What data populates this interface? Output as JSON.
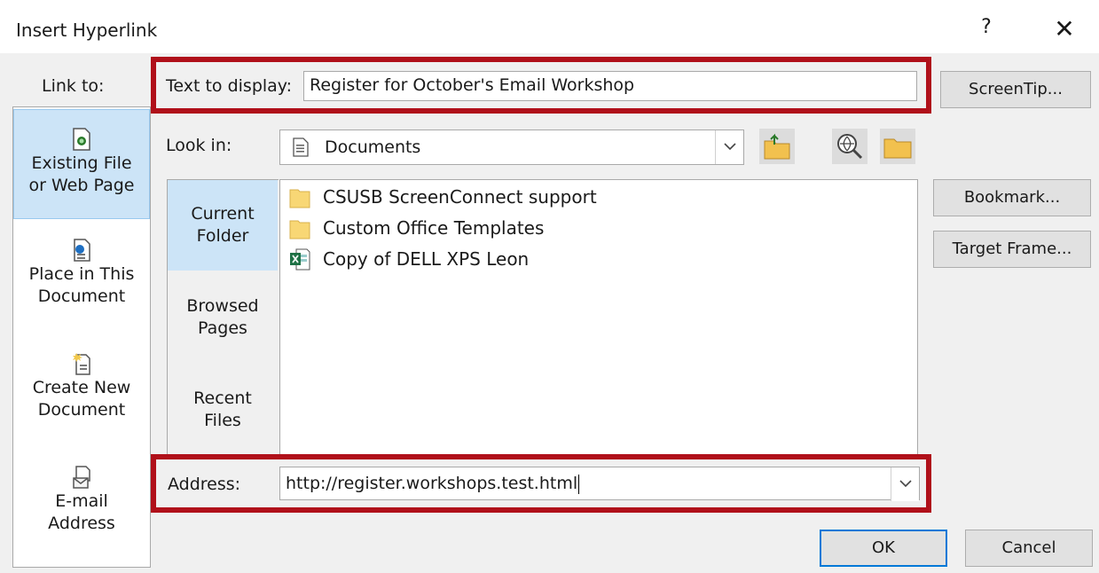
{
  "window": {
    "title": "Insert Hyperlink",
    "help_label": "?",
    "close_label": "✕"
  },
  "link_to": {
    "label": "Link to:",
    "items": [
      {
        "line1": "Existing File",
        "line2": "or Web Page",
        "icon": "web-page-icon",
        "selected": true
      },
      {
        "line1": "Place in This",
        "line2": "Document",
        "icon": "place-in-document-icon",
        "selected": false
      },
      {
        "line1": "Create New",
        "line2": "Document",
        "icon": "new-document-icon",
        "selected": false
      },
      {
        "line1": "E-mail",
        "line2": "Address",
        "icon": "email-icon",
        "selected": false
      }
    ]
  },
  "text_to_display": {
    "label": "Text to display:",
    "value": "Register for October's Email Workshop"
  },
  "buttons": {
    "screentip": "ScreenTip...",
    "bookmark": "Bookmark...",
    "target_frame": "Target Frame...",
    "ok": "OK",
    "cancel": "Cancel"
  },
  "look_in": {
    "label": "Look in:",
    "value": "Documents"
  },
  "browse_nav": {
    "items": [
      {
        "line1": "Current",
        "line2": "Folder",
        "selected": true
      },
      {
        "line1": "Browsed",
        "line2": "Pages",
        "selected": false
      },
      {
        "line1": "Recent",
        "line2": "Files",
        "selected": false
      }
    ]
  },
  "files": [
    {
      "name": "CSUSB ScreenConnect support",
      "icon": "folder-icon"
    },
    {
      "name": "Custom Office Templates",
      "icon": "folder-icon"
    },
    {
      "name": "Copy of DELL XPS Leon",
      "icon": "excel-file-icon"
    }
  ],
  "address": {
    "label": "Address:",
    "value": "http://register.workshops.test.html"
  },
  "colors": {
    "highlight_frame": "#b0101a",
    "selection": "#cce4f7",
    "dialog_bg": "#f0f0f0",
    "default_button_border": "#0078d7"
  }
}
